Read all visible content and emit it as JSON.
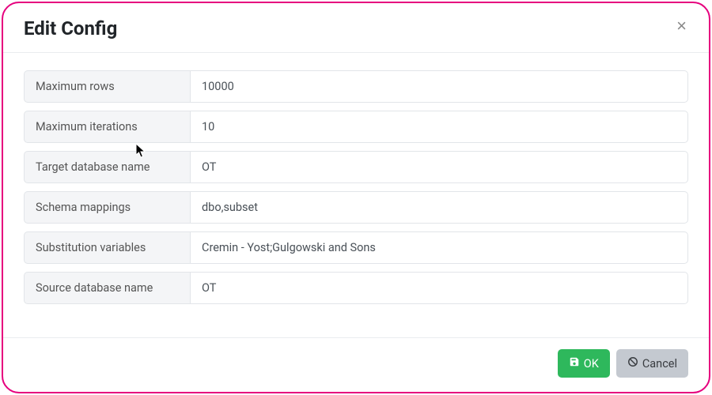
{
  "title": "Edit Config",
  "fields": [
    {
      "label": "Maximum rows",
      "value": "10000"
    },
    {
      "label": "Maximum iterations",
      "value": "10"
    },
    {
      "label": "Target database name",
      "value": "OT"
    },
    {
      "label": "Schema mappings",
      "value": "dbo,subset"
    },
    {
      "label": "Substitution variables",
      "value": "Cremin - Yost;Gulgowski and Sons"
    },
    {
      "label": "Source database name",
      "value": "OT"
    }
  ],
  "buttons": {
    "ok": "OK",
    "cancel": "Cancel"
  },
  "icons": {
    "close": "×",
    "save": "save-icon",
    "cancel": "ban-icon"
  }
}
